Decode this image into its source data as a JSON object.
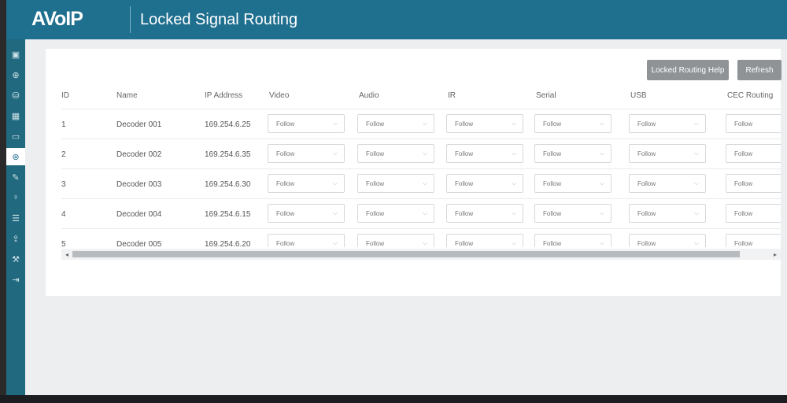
{
  "header": {
    "logo": "AVoIP",
    "title": "Locked Signal Routing"
  },
  "sidebar": {
    "items": [
      {
        "icon": "display-icon",
        "glyph": "▣"
      },
      {
        "icon": "plus-circle-icon",
        "glyph": "⊕"
      },
      {
        "icon": "database-icon",
        "glyph": "⛁"
      },
      {
        "icon": "monitor-icon",
        "glyph": "▦"
      },
      {
        "icon": "screen-icon",
        "glyph": "▭"
      },
      {
        "icon": "routing-icon",
        "glyph": "⊛",
        "active": true
      },
      {
        "icon": "pen-icon",
        "glyph": "✎"
      },
      {
        "icon": "user-icon",
        "glyph": "♀"
      },
      {
        "icon": "sliders-icon",
        "glyph": "☰"
      },
      {
        "icon": "upload-icon",
        "glyph": "⇪"
      },
      {
        "icon": "wrench-icon",
        "glyph": "⚒"
      },
      {
        "icon": "logout-icon",
        "glyph": "⇥"
      }
    ]
  },
  "toolbar": {
    "help_label": "Locked Routing Help",
    "refresh_label": "Refresh"
  },
  "table": {
    "headers": [
      "ID",
      "Name",
      "IP Address",
      "Video",
      "Audio",
      "IR",
      "Serial",
      "USB",
      "CEC Routing"
    ],
    "rows": [
      {
        "id": "1",
        "name": "Decoder 001",
        "ip": "169.254.6.25",
        "video": "Follow",
        "audio": "Follow",
        "ir": "Follow",
        "serial": "Follow",
        "usb": "Follow",
        "cec": "Follow"
      },
      {
        "id": "2",
        "name": "Decoder 002",
        "ip": "169.254.6.35",
        "video": "Follow",
        "audio": "Follow",
        "ir": "Follow",
        "serial": "Follow",
        "usb": "Follow",
        "cec": "Follow"
      },
      {
        "id": "3",
        "name": "Decoder 003",
        "ip": "169.254.6.30",
        "video": "Follow",
        "audio": "Follow",
        "ir": "Follow",
        "serial": "Follow",
        "usb": "Follow",
        "cec": "Follow"
      },
      {
        "id": "4",
        "name": "Decoder 004",
        "ip": "169.254.6.15",
        "video": "Follow",
        "audio": "Follow",
        "ir": "Follow",
        "serial": "Follow",
        "usb": "Follow",
        "cec": "Follow"
      },
      {
        "id": "5",
        "name": "Decoder 005",
        "ip": "169.254.6.20",
        "video": "Follow",
        "audio": "Follow",
        "ir": "Follow",
        "serial": "Follow",
        "usb": "Follow",
        "cec": "Follow"
      }
    ]
  },
  "scrollbar": {
    "left_arrow": "◂",
    "right_arrow": "▸"
  },
  "colors": {
    "header_bg": "#1f6f8f",
    "sidebar_bg": "#21697f",
    "button_bg": "#8f9396",
    "accent": "#1f6f8f"
  }
}
